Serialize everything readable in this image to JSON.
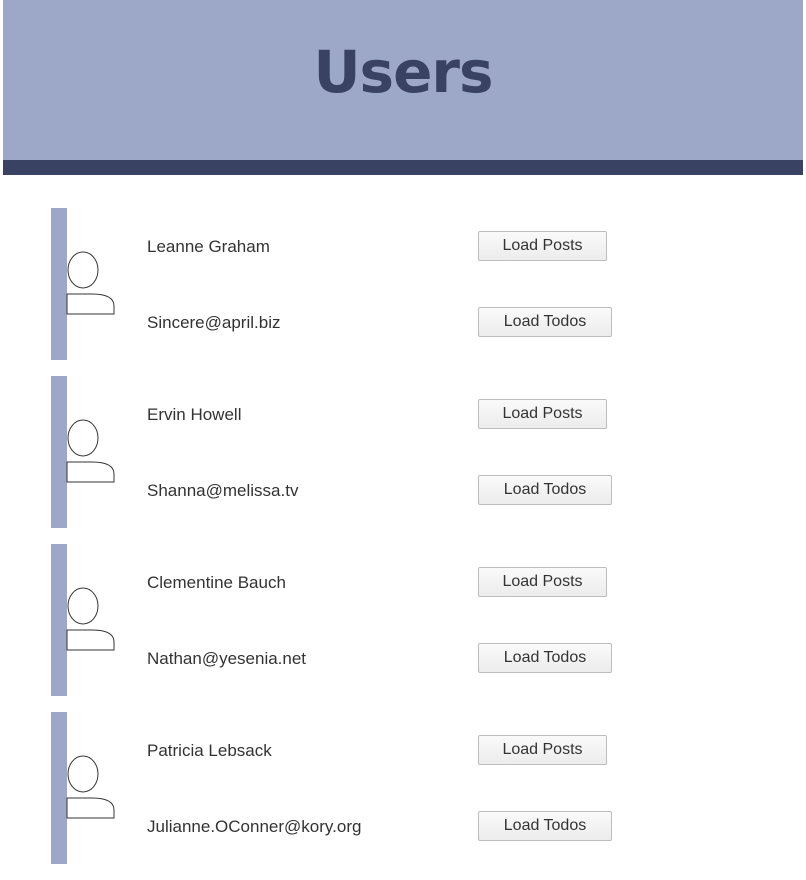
{
  "header": {
    "title": "Users"
  },
  "users": [
    {
      "name": "Leanne Graham",
      "email": "Sincere@april.biz",
      "posts_label": "Load Posts",
      "todos_label": "Load Todos"
    },
    {
      "name": "Ervin Howell",
      "email": "Shanna@melissa.tv",
      "posts_label": "Load Posts",
      "todos_label": "Load Todos"
    },
    {
      "name": "Clementine Bauch",
      "email": "Nathan@yesenia.net",
      "posts_label": "Load Posts",
      "todos_label": "Load Todos"
    },
    {
      "name": "Patricia Lebsack",
      "email": "Julianne.OConner@kory.org",
      "posts_label": "Load Posts",
      "todos_label": "Load Todos"
    }
  ],
  "icons": {
    "avatar": "user-avatar-icon"
  },
  "colors": {
    "header_bg": "#9da8c9",
    "header_bar": "#3a4263",
    "title": "#3a4263",
    "card_accent": "#9da8c9"
  }
}
